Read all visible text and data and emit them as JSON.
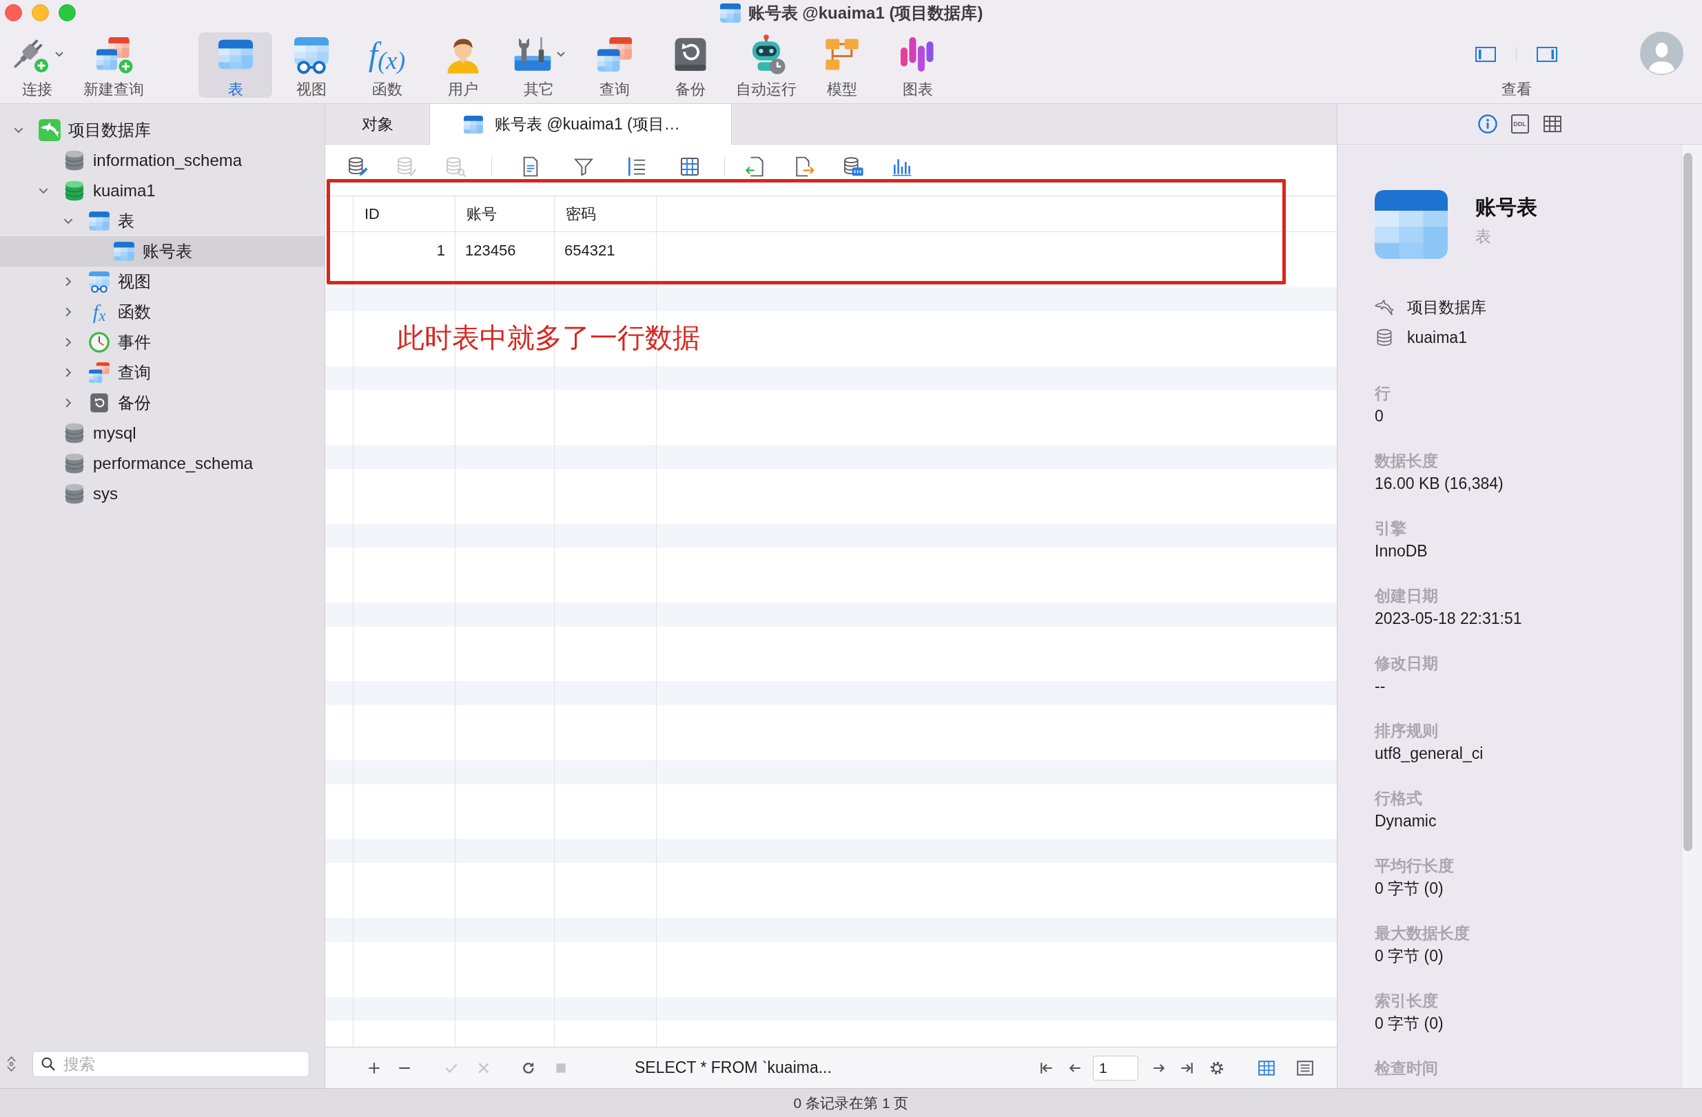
{
  "window": {
    "title": "账号表 @kuaima1 (项目数据库)"
  },
  "toolbar": {
    "items": [
      {
        "kind": "connect",
        "label": "连接",
        "selected": false,
        "menu": true
      },
      {
        "kind": "newquery",
        "label": "新建查询",
        "selected": false,
        "menu": false
      },
      {
        "kind": "table",
        "label": "表",
        "selected": true,
        "menu": false
      },
      {
        "kind": "view",
        "label": "视图",
        "selected": false,
        "menu": false
      },
      {
        "kind": "function",
        "label": "函数",
        "selected": false,
        "menu": false,
        "glyph": "f$_{(x)}$"
      },
      {
        "kind": "user",
        "label": "用户",
        "selected": false,
        "menu": false
      },
      {
        "kind": "other",
        "label": "其它",
        "selected": false,
        "menu": true
      },
      {
        "kind": "query",
        "label": "查询",
        "selected": false,
        "menu": false
      },
      {
        "kind": "backup",
        "label": "备份",
        "selected": false,
        "menu": false
      },
      {
        "kind": "automation",
        "label": "自动运行",
        "selected": false,
        "menu": false
      },
      {
        "kind": "model",
        "label": "模型",
        "selected": false,
        "menu": false
      },
      {
        "kind": "chart",
        "label": "图表",
        "selected": false,
        "menu": false
      }
    ],
    "view": {
      "label": "查看",
      "toggles": [
        {
          "kind": "sidebar",
          "on": true
        },
        {
          "kind": "inspector",
          "on": true
        }
      ]
    }
  },
  "sidebar": {
    "tree": [
      {
        "kind": "connection",
        "label": "项目数据库",
        "expanded": true,
        "selected": false,
        "children": [
          {
            "kind": "database",
            "label": "information_schema",
            "open": false,
            "selected": false
          },
          {
            "kind": "database",
            "label": "kuaima1",
            "open": true,
            "expanded": true,
            "selected": false,
            "children": [
              {
                "kind": "tables",
                "label": "表",
                "expanded": true,
                "selected": false,
                "children": [
                  {
                    "kind": "table",
                    "label": "账号表",
                    "selected": true
                  }
                ]
              },
              {
                "kind": "views",
                "label": "视图",
                "expanded": false,
                "selected": false
              },
              {
                "kind": "functions",
                "label": "函数",
                "expanded": false,
                "selected": false,
                "glyph": "f$_{x}$"
              },
              {
                "kind": "events",
                "label": "事件",
                "expanded": false,
                "selected": false
              },
              {
                "kind": "queries",
                "label": "查询",
                "expanded": false,
                "selected": false
              },
              {
                "kind": "backups",
                "label": "备份",
                "expanded": false,
                "selected": false
              }
            ]
          },
          {
            "kind": "database",
            "label": "mysql",
            "open": false,
            "selected": false
          },
          {
            "kind": "database",
            "label": "performance_schema",
            "open": false,
            "selected": false
          },
          {
            "kind": "database",
            "label": "sys",
            "open": false,
            "selected": false
          }
        ]
      }
    ],
    "search": {
      "placeholder": "搜索"
    }
  },
  "tabs": [
    {
      "kind": "objects",
      "label": "对象",
      "selected": false
    },
    {
      "kind": "table",
      "label": "账号表 @kuaima1 (项目…",
      "selected": true
    }
  ],
  "grid_toolbar": {
    "groups": [
      [
        {
          "kind": "edit",
          "disabled": false
        },
        {
          "kind": "commit",
          "disabled": true
        },
        {
          "kind": "search",
          "disabled": true
        }
      ],
      [
        {
          "kind": "text",
          "disabled": false
        },
        {
          "kind": "filter",
          "disabled": false
        },
        {
          "kind": "sort",
          "disabled": false
        },
        {
          "kind": "grid",
          "disabled": false
        }
      ],
      [
        {
          "kind": "import",
          "disabled": false
        },
        {
          "kind": "export",
          "disabled": false
        },
        {
          "kind": "data",
          "disabled": false
        },
        {
          "kind": "chart",
          "disabled": false
        }
      ]
    ]
  },
  "table": {
    "columns": [
      {
        "label": "ID",
        "numeric": true
      },
      {
        "label": "账号",
        "numeric": false
      },
      {
        "label": "密码",
        "numeric": false
      }
    ],
    "rows": [
      [
        "1",
        "123456",
        "654321"
      ]
    ]
  },
  "annotation": {
    "text": "此时表中就多了一行数据"
  },
  "bottom_bar": {
    "edit_buttons": [
      {
        "kind": "add",
        "disabled": false
      },
      {
        "kind": "remove",
        "disabled": false
      },
      {
        "kind": "apply",
        "disabled": true
      },
      {
        "kind": "discard",
        "disabled": true
      },
      {
        "kind": "refresh",
        "disabled": false
      },
      {
        "kind": "stop",
        "disabled": true
      }
    ],
    "sql": "SELECT * FROM `kuaima...",
    "page": "1",
    "view_modes": [
      {
        "kind": "grid",
        "selected": true
      },
      {
        "kind": "form",
        "selected": false
      }
    ]
  },
  "inspector": {
    "tabs": [
      {
        "kind": "info",
        "selected": true
      },
      {
        "kind": "ddl",
        "label": "DDL",
        "selected": false
      },
      {
        "kind": "columns",
        "selected": false
      }
    ],
    "name": "账号表",
    "type": "表",
    "location": [
      {
        "kind": "connection",
        "text": "项目数据库"
      },
      {
        "kind": "database",
        "text": "kuaima1"
      }
    ],
    "fields": [
      {
        "label": "行",
        "value": "0"
      },
      {
        "label": "数据长度",
        "value": "16.00 KB (16,384)"
      },
      {
        "label": "引擎",
        "value": "InnoDB"
      },
      {
        "label": "创建日期",
        "value": "2023-05-18 22:31:51"
      },
      {
        "label": "修改日期",
        "value": "--"
      },
      {
        "label": "排序规则",
        "value": "utf8_general_ci"
      },
      {
        "label": "行格式",
        "value": "Dynamic"
      },
      {
        "label": "平均行长度",
        "value": "0 字节 (0)"
      },
      {
        "label": "最大数据长度",
        "value": "0 字节 (0)"
      },
      {
        "label": "索引长度",
        "value": "0 字节 (0)"
      },
      {
        "label": "检查时间"
      }
    ]
  },
  "status_bar": {
    "text": "0 条记录在第 1 页"
  }
}
